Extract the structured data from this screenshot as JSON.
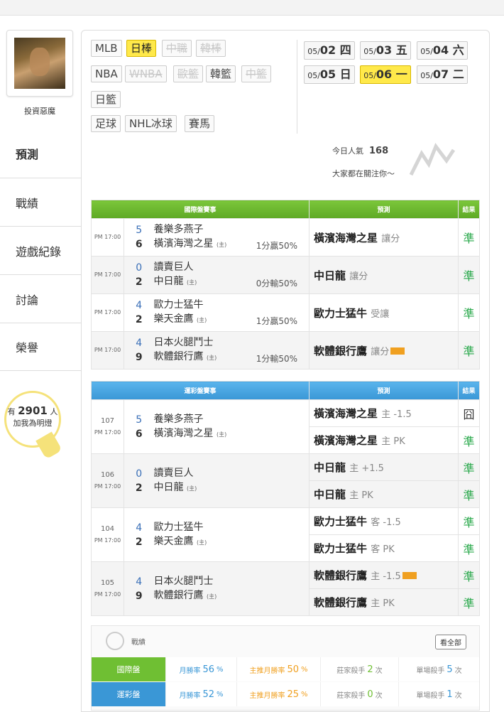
{
  "user": {
    "name": "投資惡魔"
  },
  "nav": [
    "預測",
    "戰績",
    "遊戲紀錄",
    "討論",
    "榮譽"
  ],
  "fans": {
    "prefix": "有",
    "count": "2901",
    "suffix": "人",
    "cta": "加我為明燈"
  },
  "sports": [
    {
      "label": "MLB",
      "state": "normal"
    },
    {
      "label": "日棒",
      "state": "active"
    },
    {
      "label": "中職",
      "state": "disabled"
    },
    {
      "label": "韓棒",
      "state": "disabled"
    },
    {
      "label": "NBA",
      "state": "normal"
    },
    {
      "label": "WNBA",
      "state": "disabled"
    },
    {
      "label": "歐籃",
      "state": "disabled"
    },
    {
      "label": "韓籃",
      "state": "normal"
    },
    {
      "label": "中籃",
      "state": "disabled"
    },
    {
      "label": "日籃",
      "state": "normal"
    },
    {
      "label": "足球",
      "state": "normal"
    },
    {
      "label": "NHL冰球",
      "state": "normal"
    },
    {
      "label": "賽馬",
      "state": "normal"
    }
  ],
  "dates": [
    {
      "md": "05/",
      "d": "02",
      "w": "四"
    },
    {
      "md": "05/",
      "d": "03",
      "w": "五"
    },
    {
      "md": "05/",
      "d": "04",
      "w": "六"
    },
    {
      "md": "05/",
      "d": "05",
      "w": "日"
    },
    {
      "md": "05/",
      "d": "06",
      "w": "一",
      "active": true
    },
    {
      "md": "05/",
      "d": "07",
      "w": "二"
    }
  ],
  "popularity": {
    "label": "今日人氣",
    "value": "168",
    "note": "大家都在關注你〜"
  },
  "intl": {
    "headers": [
      "國際盤賽事",
      "預測",
      "結果"
    ],
    "games": [
      {
        "time": "PM 17:00",
        "s1": "5",
        "t1": "養樂多燕子",
        "s2": "6",
        "t2": "橫濱海灣之星",
        "home": "(主)",
        "hc": "1分贏50%",
        "pick": "橫濱海灣之星",
        "pick_type": "讓分",
        "badge": false,
        "result": "準"
      },
      {
        "time": "PM 17:00",
        "s1": "0",
        "t1": "讀賣巨人",
        "s2": "2",
        "t2": "中日龍",
        "home": "(主)",
        "hc": "0分輸50%",
        "pick": "中日龍",
        "pick_type": "讓分",
        "badge": false,
        "result": "準"
      },
      {
        "time": "PM 17:00",
        "s1": "4",
        "t1": "歐力士猛牛",
        "s2": "2",
        "t2": "樂天金鷹",
        "home": "(主)",
        "hc": "1分贏50%",
        "pick": "歐力士猛牛",
        "pick_type": "受讓",
        "badge": false,
        "result": "準"
      },
      {
        "time": "PM 17:00",
        "s1": "4",
        "t1": "日本火腿鬥士",
        "s2": "9",
        "t2": "軟體銀行鷹",
        "home": "(主)",
        "hc": "1分輸50%",
        "pick": "軟體銀行鷹",
        "pick_type": "讓分",
        "badge": true,
        "result": "準"
      }
    ]
  },
  "lottery": {
    "headers": [
      "運彩盤賽事",
      "預測",
      "結果"
    ],
    "games": [
      {
        "no": "107",
        "time": "PM 17:00",
        "s1": "5",
        "t1": "養樂多燕子",
        "s2": "6",
        "t2": "橫濱海灣之星",
        "home": "(主)",
        "picks": [
          {
            "team": "橫濱海灣之星",
            "detail": "主 -1.5",
            "badge": false,
            "result": "囧"
          },
          {
            "team": "橫濱海灣之星",
            "detail": "主 PK",
            "badge": false,
            "result": "準"
          }
        ]
      },
      {
        "no": "106",
        "time": "PM 17:00",
        "s1": "0",
        "t1": "讀賣巨人",
        "s2": "2",
        "t2": "中日龍",
        "home": "(主)",
        "picks": [
          {
            "team": "中日龍",
            "detail": "主 +1.5",
            "badge": false,
            "result": "準"
          },
          {
            "team": "中日龍",
            "detail": "主 PK",
            "badge": false,
            "result": "準"
          }
        ]
      },
      {
        "no": "104",
        "time": "PM 17:00",
        "s1": "4",
        "t1": "歐力士猛牛",
        "s2": "2",
        "t2": "樂天金鷹",
        "home": "(主)",
        "picks": [
          {
            "team": "歐力士猛牛",
            "detail": "客 -1.5",
            "badge": false,
            "result": "準"
          },
          {
            "team": "歐力士猛牛",
            "detail": "客 PK",
            "badge": false,
            "result": "準"
          }
        ]
      },
      {
        "no": "105",
        "time": "PM 17:00",
        "s1": "4",
        "t1": "日本火腿鬥士",
        "s2": "9",
        "t2": "軟體銀行鷹",
        "home": "(主)",
        "picks": [
          {
            "team": "軟體銀行鷹",
            "detail": "主 -1.5",
            "badge": true,
            "result": "準"
          },
          {
            "team": "軟體銀行鷹",
            "detail": "主 PK",
            "badge": false,
            "result": "準"
          }
        ]
      }
    ]
  },
  "record": {
    "title": "戰績",
    "see_all": "看全部",
    "rows": [
      {
        "label": "國際盤",
        "color": "#6fbf33",
        "month_label": "月勝率",
        "month": "56",
        "month_unit": "%",
        "main_label": "主推月勝率",
        "main": "50",
        "main_unit": "%",
        "bank_label": "莊家殺手",
        "bank": "2",
        "bank_unit": "次",
        "single_label": "單場殺手",
        "single": "5",
        "single_unit": "次"
      },
      {
        "label": "運彩盤",
        "color": "#3a97d6",
        "month_label": "月勝率",
        "month": "52",
        "month_unit": "%",
        "main_label": "主推月勝率",
        "main": "25",
        "main_unit": "%",
        "bank_label": "莊家殺手",
        "bank": "0",
        "bank_unit": "次",
        "single_label": "單場殺手",
        "single": "1",
        "single_unit": "次"
      }
    ]
  },
  "colors": {
    "accent_yellow": "#ffe94a",
    "green": "#6fbf33",
    "blue": "#3a97d6",
    "result_green": "#28a84a"
  }
}
